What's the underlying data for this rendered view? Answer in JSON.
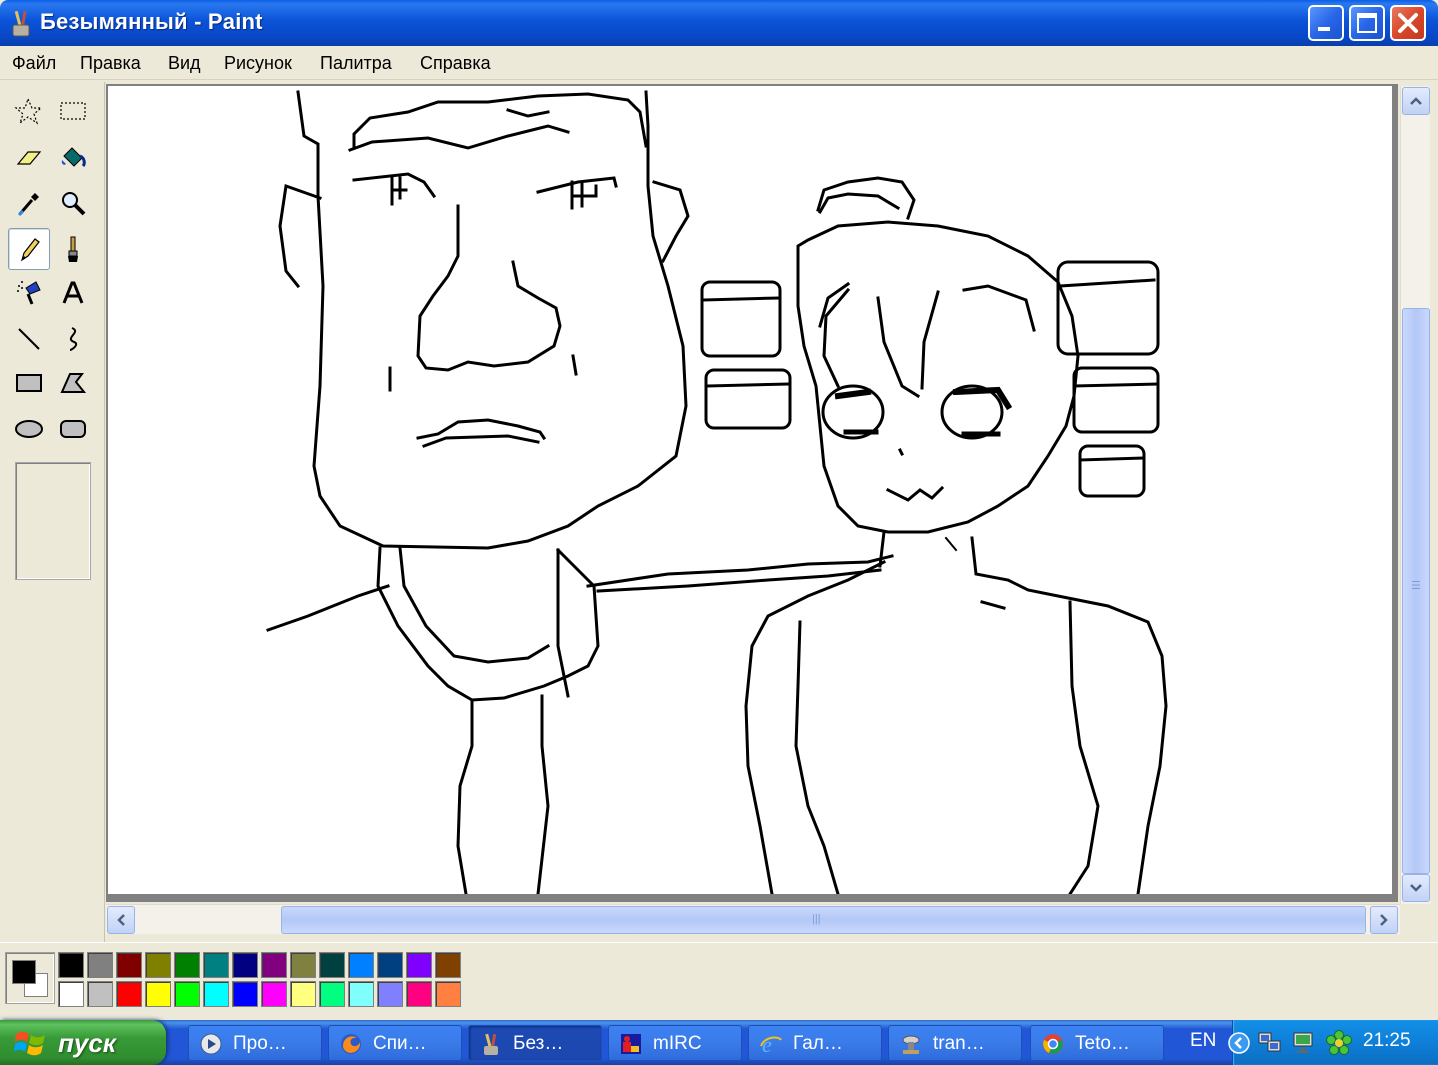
{
  "window": {
    "title": "Безымянный - Paint"
  },
  "menu": [
    "Файл",
    "Правка",
    "Вид",
    "Рисунок",
    "Палитра",
    "Справка"
  ],
  "tools": [
    {
      "id": "free-select",
      "icon": "free-form-select-icon"
    },
    {
      "id": "rect-select",
      "icon": "rect-select-icon"
    },
    {
      "id": "eraser",
      "icon": "eraser-icon"
    },
    {
      "id": "fill",
      "icon": "fill-bucket-icon"
    },
    {
      "id": "picker",
      "icon": "color-picker-icon"
    },
    {
      "id": "magnifier",
      "icon": "magnifier-icon"
    },
    {
      "id": "pencil",
      "icon": "pencil-icon",
      "selected": true
    },
    {
      "id": "brush",
      "icon": "brush-icon"
    },
    {
      "id": "airbrush",
      "icon": "airbrush-icon"
    },
    {
      "id": "text",
      "icon": "text-icon"
    },
    {
      "id": "line",
      "icon": "line-icon"
    },
    {
      "id": "curve",
      "icon": "curve-icon"
    },
    {
      "id": "rectangle",
      "icon": "rectangle-icon"
    },
    {
      "id": "polygon",
      "icon": "polygon-icon"
    },
    {
      "id": "ellipse",
      "icon": "ellipse-icon"
    },
    {
      "id": "rounded-rect",
      "icon": "rounded-rect-icon"
    }
  ],
  "palette": {
    "foreground": "#000000",
    "background": "#FFFFFF",
    "row1": [
      "#000000",
      "#808080",
      "#800000",
      "#808000",
      "#008000",
      "#008080",
      "#000080",
      "#800080",
      "#808040",
      "#004040",
      "#0080FF",
      "#004080",
      "#8000FF",
      "#804000"
    ],
    "row2": [
      "#FFFFFF",
      "#C0C0C0",
      "#FF0000",
      "#FFFF00",
      "#00FF00",
      "#00FFFF",
      "#0000FF",
      "#FF00FF",
      "#FFFF80",
      "#00FF80",
      "#80FFFF",
      "#8080FF",
      "#FF0080",
      "#FF8040"
    ]
  },
  "taskbar": {
    "start_label": "пуск",
    "tasks": [
      {
        "label": "Про…",
        "icon": "media-player-icon",
        "active": false
      },
      {
        "label": "Спи…",
        "icon": "firefox-icon",
        "active": false
      },
      {
        "label": "Без…",
        "icon": "paint-icon",
        "active": true
      },
      {
        "label": "mIRC",
        "icon": "mirc-icon",
        "active": false
      },
      {
        "label": "Гал…",
        "icon": "ie-icon",
        "active": false
      },
      {
        "label": "tran…",
        "icon": "transfer-icon",
        "active": false
      },
      {
        "label": "Teto…",
        "icon": "chrome-icon",
        "active": false
      }
    ],
    "language": "EN",
    "clock": "21:25"
  }
}
